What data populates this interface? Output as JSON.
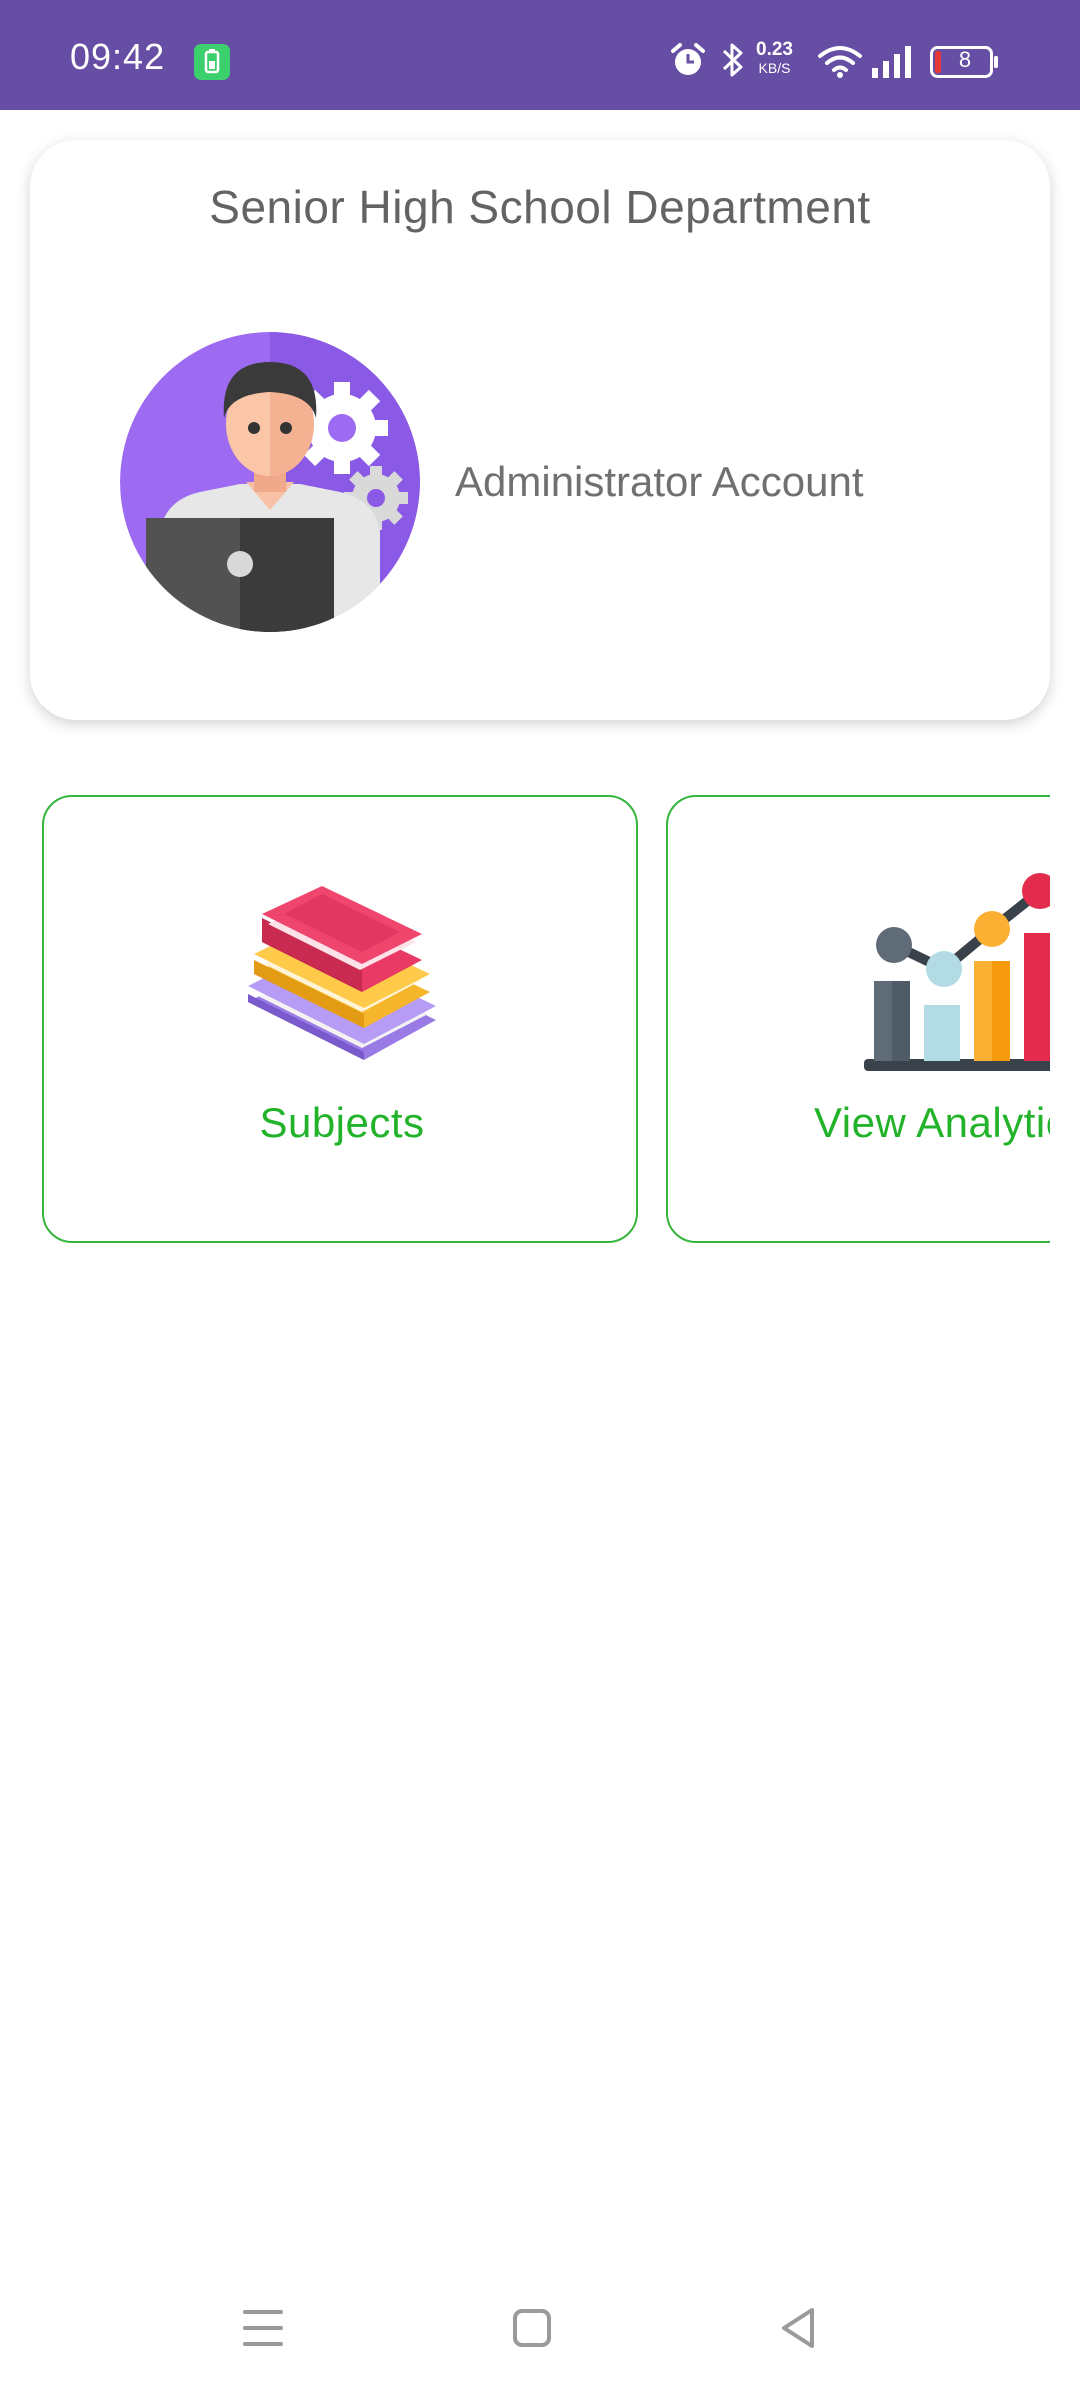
{
  "status_bar": {
    "time": "09:42",
    "net_speed_value": "0.23",
    "net_speed_unit": "KB/S",
    "battery_level": "8",
    "icons": [
      "battery-saver-app-icon",
      "alarm-icon",
      "bluetooth-icon",
      "wifi-icon",
      "signal-icon",
      "battery-icon"
    ],
    "background": "#654ea3"
  },
  "header": {
    "title": "Senior High School Department",
    "account_label": "Administrator Account",
    "avatar_icon": "admin-avatar-icon"
  },
  "tiles": [
    {
      "label": "Subjects",
      "icon": "books-icon"
    },
    {
      "label": "View Analytics",
      "icon": "analytics-chart-icon"
    }
  ],
  "accent_color": "#22b32b",
  "nav_bar": {
    "icons": [
      "menu-icon",
      "home-icon",
      "back-icon"
    ]
  }
}
